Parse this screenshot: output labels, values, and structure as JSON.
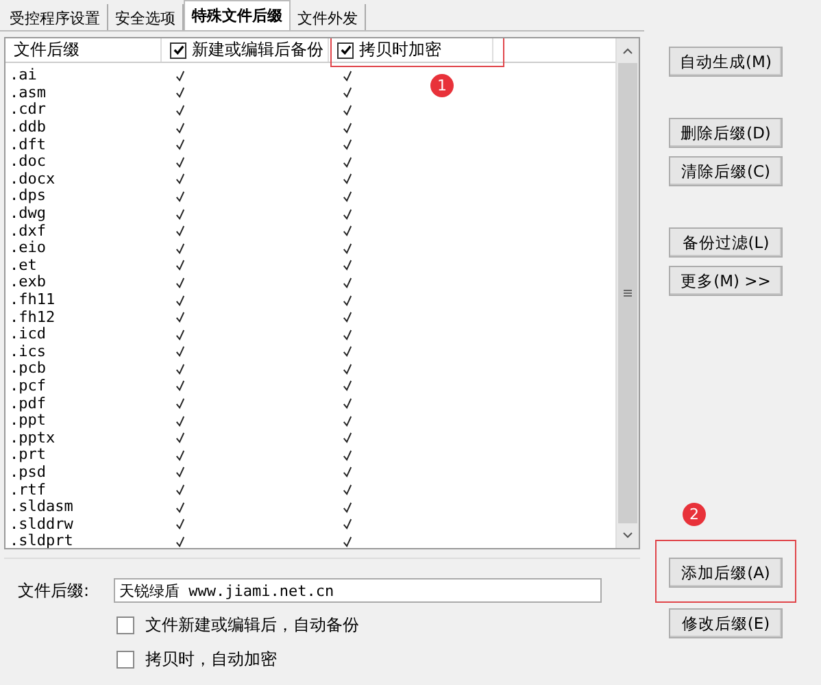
{
  "tabs": [
    {
      "label": "受控程序设置",
      "selected": false
    },
    {
      "label": "安全选项",
      "selected": false
    },
    {
      "label": "特殊文件后缀",
      "selected": true
    },
    {
      "label": "文件外发",
      "selected": false
    }
  ],
  "table": {
    "columns": [
      {
        "label": "文件后缀",
        "kind": "text"
      },
      {
        "label": "新建或编辑后备份",
        "kind": "check",
        "checked": true
      },
      {
        "label": "拷贝时加密",
        "kind": "check",
        "checked": true,
        "badge": "1"
      }
    ],
    "rows": [
      {
        "ext": ".ai",
        "backup": true,
        "encrypt": true
      },
      {
        "ext": ".asm",
        "backup": true,
        "encrypt": true
      },
      {
        "ext": ".cdr",
        "backup": true,
        "encrypt": true
      },
      {
        "ext": ".ddb",
        "backup": true,
        "encrypt": true
      },
      {
        "ext": ".dft",
        "backup": true,
        "encrypt": true
      },
      {
        "ext": ".doc",
        "backup": true,
        "encrypt": true
      },
      {
        "ext": ".docx",
        "backup": true,
        "encrypt": true
      },
      {
        "ext": ".dps",
        "backup": true,
        "encrypt": true
      },
      {
        "ext": ".dwg",
        "backup": true,
        "encrypt": true
      },
      {
        "ext": ".dxf",
        "backup": true,
        "encrypt": true
      },
      {
        "ext": ".eio",
        "backup": true,
        "encrypt": true
      },
      {
        "ext": ".et",
        "backup": true,
        "encrypt": true
      },
      {
        "ext": ".exb",
        "backup": true,
        "encrypt": true
      },
      {
        "ext": ".fh11",
        "backup": true,
        "encrypt": true
      },
      {
        "ext": ".fh12",
        "backup": true,
        "encrypt": true
      },
      {
        "ext": ".icd",
        "backup": true,
        "encrypt": true
      },
      {
        "ext": ".ics",
        "backup": true,
        "encrypt": true
      },
      {
        "ext": ".pcb",
        "backup": true,
        "encrypt": true
      },
      {
        "ext": ".pcf",
        "backup": true,
        "encrypt": true
      },
      {
        "ext": ".pdf",
        "backup": true,
        "encrypt": true
      },
      {
        "ext": ".ppt",
        "backup": true,
        "encrypt": true
      },
      {
        "ext": ".pptx",
        "backup": true,
        "encrypt": true
      },
      {
        "ext": ".prt",
        "backup": true,
        "encrypt": true
      },
      {
        "ext": ".psd",
        "backup": true,
        "encrypt": true
      },
      {
        "ext": ".rtf",
        "backup": true,
        "encrypt": true
      },
      {
        "ext": ".sldasm",
        "backup": true,
        "encrypt": true
      },
      {
        "ext": ".slddrw",
        "backup": true,
        "encrypt": true
      },
      {
        "ext": ".sldprt",
        "backup": true,
        "encrypt": true
      }
    ]
  },
  "form": {
    "label": "文件后缀:",
    "value": "天锐绿盾 www.jiami.net.cn",
    "options": [
      {
        "label": "文件新建或编辑后，自动备份",
        "checked": false
      },
      {
        "label": "拷贝时，自动加密",
        "checked": false
      }
    ]
  },
  "buttons": [
    {
      "label": "自动生成(M)"
    },
    {
      "label": "删除后缀(D)"
    },
    {
      "label": "清除后缀(C)"
    },
    {
      "label": "备份过滤(L)"
    },
    {
      "label": "更多(M) >>"
    },
    {
      "label": "添加后缀(A)",
      "badge": "2"
    },
    {
      "label": "修改后缀(E)"
    }
  ]
}
